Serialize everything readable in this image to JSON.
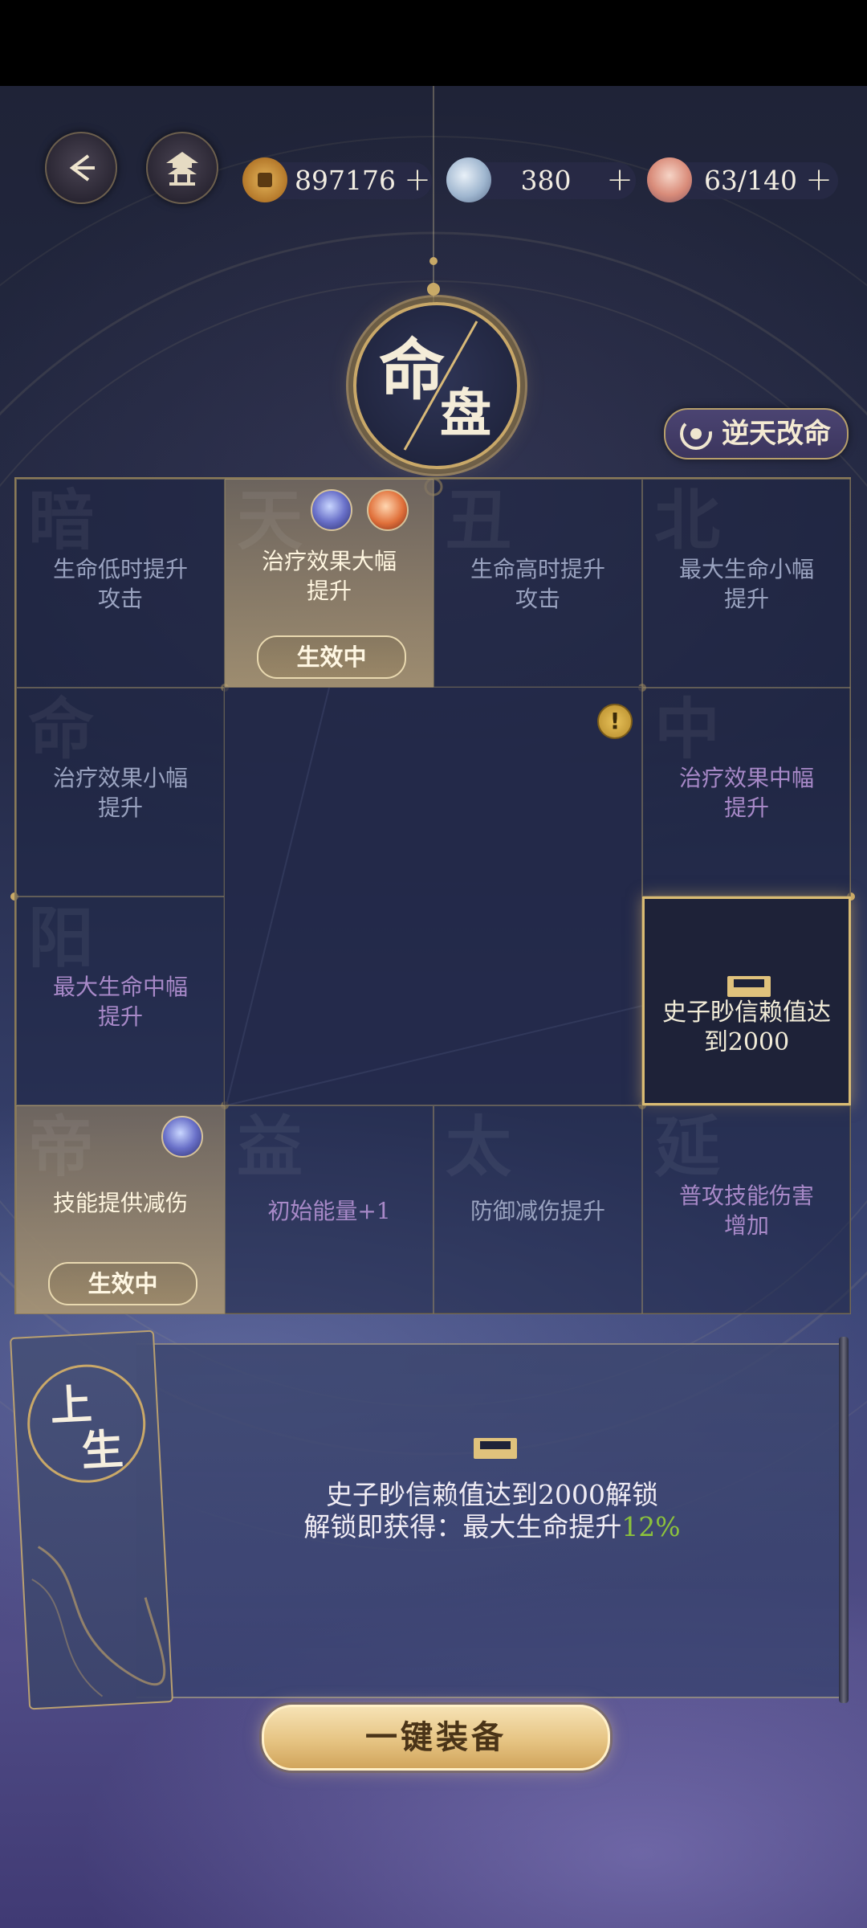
{
  "resources": {
    "coins": {
      "icon": "copper-coin-icon",
      "value": "897176"
    },
    "gems": {
      "icon": "jade-orb-icon",
      "value": "380"
    },
    "stamina": {
      "icon": "food-bowl-icon",
      "value": "63/140"
    }
  },
  "header": {
    "back_icon": "back-arrow-icon",
    "pavilion_icon": "pavilion-icon",
    "title_chars": [
      "命",
      "盘"
    ],
    "fate_button_label": "逆天改命"
  },
  "grid": {
    "cells": [
      {
        "label": "生命低时提升攻击",
        "lines": [
          "生命低时提升",
          "攻击"
        ],
        "watermark": "暗",
        "state": "locked"
      },
      {
        "label": "治疗效果大幅提升",
        "lines": [
          "治疗效果大幅",
          "提升"
        ],
        "watermark": "天",
        "state": "active",
        "badge": "生效中"
      },
      {
        "label": "生命高时提升攻击",
        "lines": [
          "生命高时提升",
          "攻击"
        ],
        "watermark": "丑",
        "state": "locked"
      },
      {
        "label": "最大生命小幅提升",
        "lines": [
          "最大生命小幅",
          "提升"
        ],
        "watermark": "北",
        "state": "locked"
      },
      {
        "label": "治疗效果小幅提升",
        "lines": [
          "治疗效果小幅",
          "提升"
        ],
        "watermark": "命",
        "state": "locked"
      },
      {
        "label": "治疗效果中幅提升",
        "lines": [
          "治疗效果中幅",
          "提升"
        ],
        "watermark": "中",
        "state": "purple"
      },
      {
        "label": "最大生命中幅提升",
        "lines": [
          "最大生命中幅",
          "提升"
        ],
        "watermark": "阳",
        "state": "purple"
      },
      {
        "label": "史子眇信赖值达到2000",
        "lines": [
          "史子眇信赖值达",
          "到2000"
        ],
        "watermark": "",
        "state": "selected"
      },
      {
        "label": "技能提供减伤",
        "lines": [
          "技能提供减伤"
        ],
        "watermark": "帝",
        "state": "active",
        "badge": "生效中"
      },
      {
        "label": "初始能量+1",
        "lines": [
          "初始能量+1"
        ],
        "watermark": "益",
        "state": "purple"
      },
      {
        "label": "防御减伤提升",
        "lines": [
          "防御减伤提升"
        ],
        "watermark": "太",
        "state": "locked"
      },
      {
        "label": "普攻技能伤害增加",
        "lines": [
          "普攻技能伤害",
          "增加"
        ],
        "watermark": "延",
        "state": "purple"
      }
    ]
  },
  "detail": {
    "tag_chars": [
      "上",
      "生"
    ],
    "lock_icon": "chest-icon",
    "line1": "史子眇信赖值达到2000解锁",
    "line2_prefix": "解锁即获得：最大生命提升",
    "line2_highlight": "12%"
  },
  "equip_button_label": "一键装备",
  "colors": {
    "gold": "#d9bb73",
    "text_locked": "#9aa3c0",
    "text_purple": "#a889c8",
    "text_active": "#fff6e0",
    "highlight_green": "#8cc23c"
  }
}
